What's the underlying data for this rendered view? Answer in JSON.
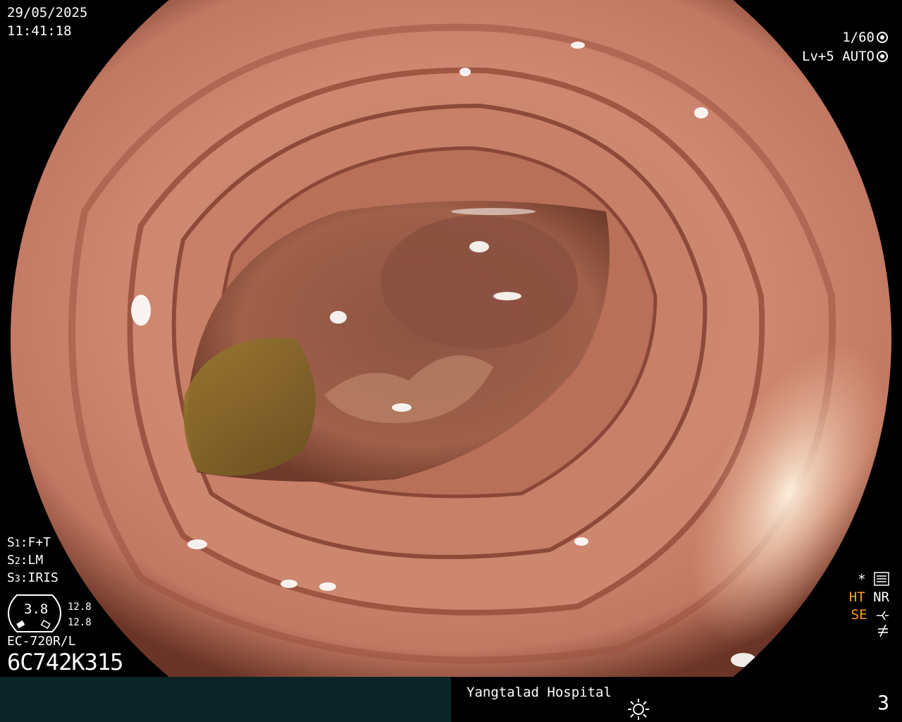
{
  "header": {
    "date": "29/05/2025",
    "time": "11:41:18",
    "shutter": "1/60",
    "level": "Lv+5",
    "iris_mode": "AUTO"
  },
  "settings": {
    "s1_label": "S",
    "s1_sub": "1",
    "s1_value": ":F+T",
    "s2_label": "S",
    "s2_sub": "2",
    "s2_value": ":LM",
    "s3_label": "S",
    "s3_sub": "3",
    "s3_value": ":IRIS"
  },
  "scope": {
    "dial_value": "3.8",
    "readout_top": "12.8",
    "readout_bottom": "12.8",
    "model": "EC-720R/L",
    "serial": "6C742K315"
  },
  "indicators": {
    "star": "*",
    "ht": "HT",
    "nr": "NR",
    "se": "SE"
  },
  "footer": {
    "hospital": "Yangtalad Hospital",
    "page_number": "3"
  },
  "colors": {
    "mucosa": "#c9806a",
    "lumen": "#7a4a38",
    "fluid": "#8a6a28",
    "highlight_orange": "#ffa020",
    "footer_left": "#0b2426"
  }
}
